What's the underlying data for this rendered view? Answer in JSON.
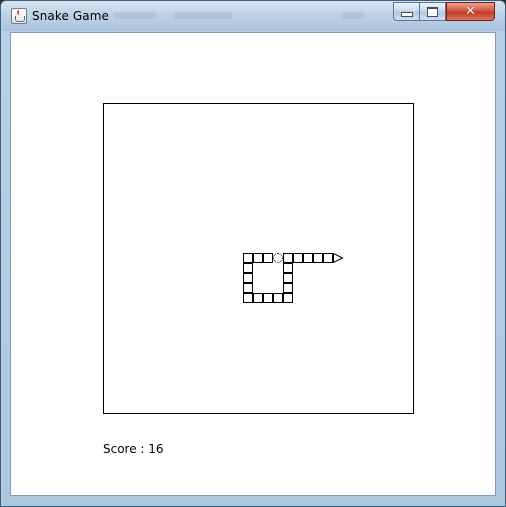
{
  "window": {
    "title": "Snake Game",
    "close_glyph": "✕"
  },
  "score": {
    "label": "Score : 16",
    "value": 16
  },
  "game": {
    "head_direction": "right",
    "food": {
      "cell": [
        17,
        15
      ]
    },
    "snake": [
      [
        16,
        15
      ],
      [
        15,
        15
      ],
      [
        14,
        15
      ],
      [
        14,
        16
      ],
      [
        14,
        17
      ],
      [
        14,
        18
      ],
      [
        14,
        19
      ],
      [
        15,
        19
      ],
      [
        16,
        19
      ],
      [
        17,
        19
      ],
      [
        18,
        19
      ],
      [
        18,
        18
      ],
      [
        18,
        17
      ],
      [
        18,
        16
      ],
      [
        18,
        15
      ],
      [
        19,
        15
      ],
      [
        20,
        15
      ],
      [
        21,
        15
      ],
      [
        22,
        15
      ]
    ]
  }
}
